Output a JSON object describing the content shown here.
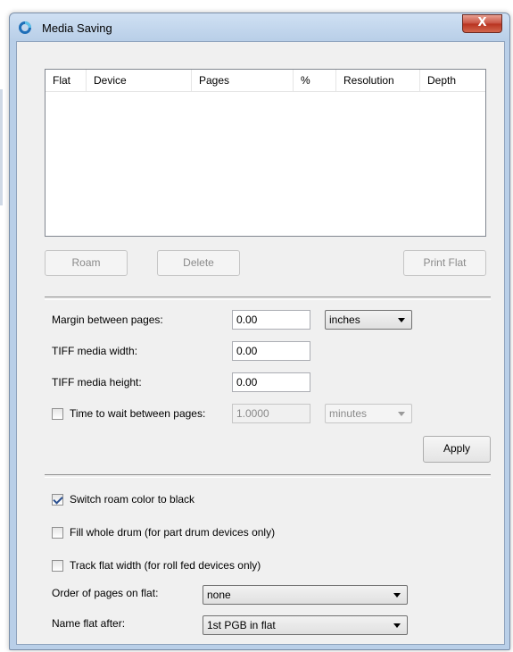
{
  "window": {
    "title": "Media Saving",
    "close_glyph": "X",
    "icon": "app-ring-icon"
  },
  "flat_table": {
    "columns": [
      "Flat",
      "Device",
      "Pages",
      "%",
      "Resolution",
      "Depth"
    ],
    "rows": []
  },
  "buttons": {
    "roam": "Roam",
    "delete": "Delete",
    "print_flat": "Print Flat",
    "apply": "Apply"
  },
  "settings": {
    "margin_label": "Margin between pages:",
    "margin_value": "0.00",
    "margin_unit": "inches",
    "tiff_width_label": "TIFF media width:",
    "tiff_width_value": "0.00",
    "tiff_height_label": "TIFF media height:",
    "tiff_height_value": "0.00",
    "wait_label": "Time to wait between pages:",
    "wait_value": "1.0000",
    "wait_unit": "minutes",
    "wait_checked": false
  },
  "options": {
    "switch_roam_label": "Switch roam color to black",
    "switch_roam_checked": true,
    "fill_drum_label": "Fill whole drum (for part drum devices only)",
    "fill_drum_checked": false,
    "track_width_label": "Track flat width (for roll fed devices only)",
    "track_width_checked": false,
    "order_label": "Order of pages on flat:",
    "order_value": "none",
    "name_label": "Name flat after:",
    "name_value": "1st PGB in flat"
  }
}
